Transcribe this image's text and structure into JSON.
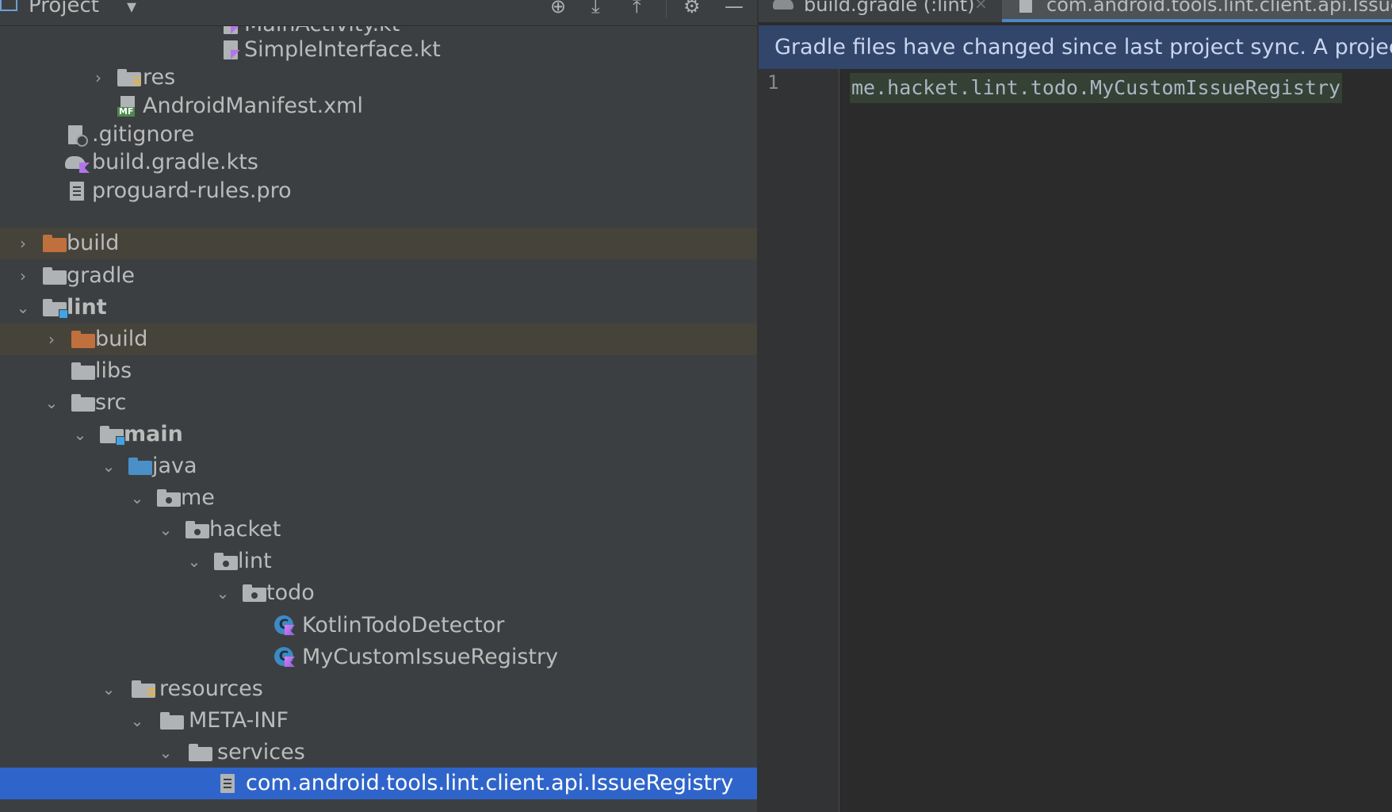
{
  "project_panel": {
    "title": "Project",
    "header_icons": [
      "locate-icon",
      "expand-all-icon",
      "collapse-all-icon",
      "gear-icon",
      "minimize-icon"
    ],
    "tree": [
      {
        "label": "MainActivity.kt",
        "icon": "kotlin-file-icon"
      },
      {
        "label": "SimpleInterface.kt",
        "icon": "kotlin-file-icon"
      },
      {
        "label": "res",
        "icon": "resource-folder-icon",
        "expanded": false
      },
      {
        "label": "AndroidManifest.xml",
        "icon": "manifest-file-icon"
      },
      {
        "label": ".gitignore",
        "icon": "gitignore-file-icon"
      },
      {
        "label": "build.gradle.kts",
        "icon": "gradle-kts-file-icon"
      },
      {
        "label": "proguard-rules.pro",
        "icon": "text-file-icon"
      },
      {
        "label": "build",
        "icon": "excluded-folder-icon",
        "expanded": false
      },
      {
        "label": "gradle",
        "icon": "folder-icon",
        "expanded": false
      },
      {
        "label": "lint",
        "icon": "module-folder-icon",
        "expanded": true
      },
      {
        "label": "build",
        "icon": "excluded-folder-icon",
        "expanded": false
      },
      {
        "label": "libs",
        "icon": "folder-icon"
      },
      {
        "label": "src",
        "icon": "folder-icon",
        "expanded": true
      },
      {
        "label": "main",
        "icon": "module-folder-icon",
        "expanded": true
      },
      {
        "label": "java",
        "icon": "source-folder-icon",
        "expanded": true
      },
      {
        "label": "me",
        "icon": "package-icon",
        "expanded": true
      },
      {
        "label": "hacket",
        "icon": "package-icon",
        "expanded": true
      },
      {
        "label": "lint",
        "icon": "package-icon",
        "expanded": true
      },
      {
        "label": "todo",
        "icon": "package-icon",
        "expanded": true
      },
      {
        "label": "KotlinTodoDetector",
        "icon": "kotlin-class-icon"
      },
      {
        "label": "MyCustomIssueRegistry",
        "icon": "kotlin-class-icon"
      },
      {
        "label": "resources",
        "icon": "resource-folder-icon",
        "expanded": true
      },
      {
        "label": "META-INF",
        "icon": "folder-icon",
        "expanded": true
      },
      {
        "label": "services",
        "icon": "folder-icon",
        "expanded": true
      },
      {
        "label": "com.android.tools.lint.client.api.IssueRegistry",
        "icon": "text-file-icon",
        "selected": true
      }
    ]
  },
  "editor": {
    "tabs": [
      {
        "label": "build.gradle (:lint)",
        "icon": "gradle-file-icon"
      },
      {
        "label": "com.android.tools.lint.client.api.IssueRegistry",
        "icon": "text-file-icon",
        "active": true
      }
    ],
    "banner": "Gradle files have changed since last project sync. A project sync may be necessary for the IDE to work properly.",
    "line_number": "1",
    "code_line": "me.hacket.lint.todo.MyCustomIssueRegistry"
  },
  "colors": {
    "selection": "#2f65ca",
    "excluded_row": "#46433b",
    "banner": "#32456a",
    "panel_bg": "#3c3f41",
    "editor_bg": "#2b2b2b"
  }
}
